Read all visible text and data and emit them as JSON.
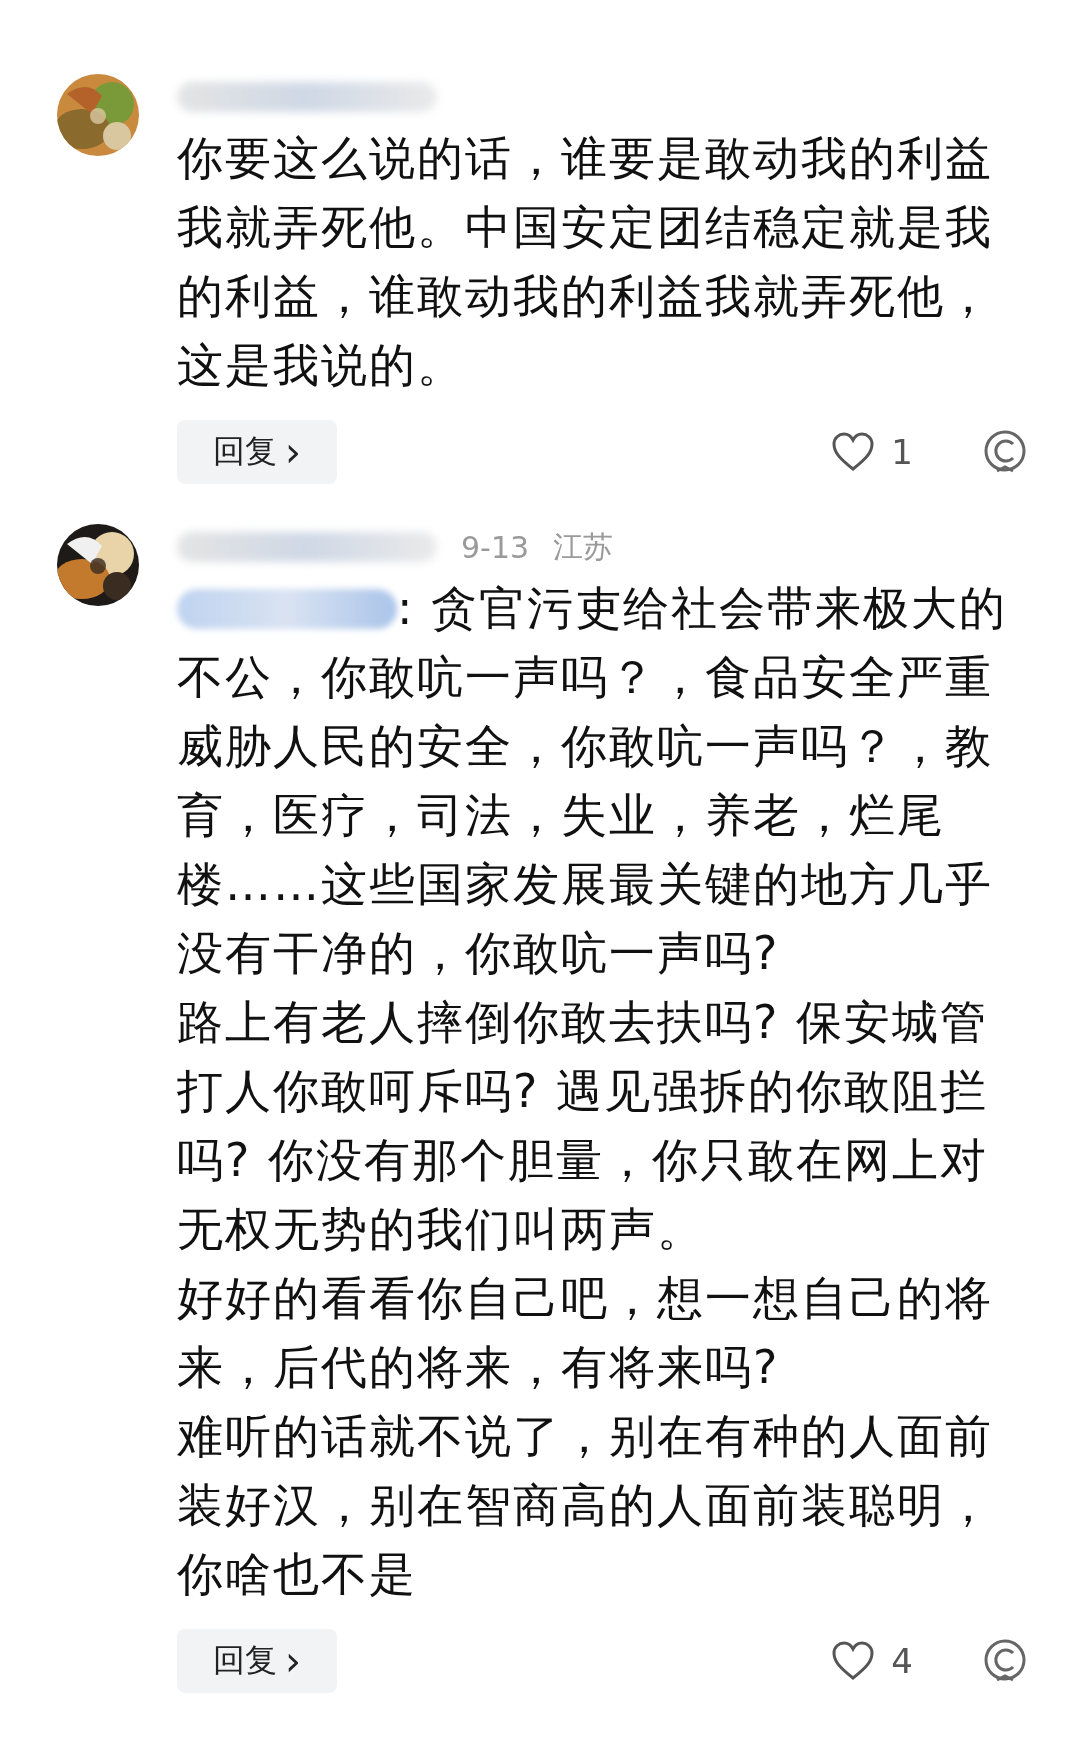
{
  "comments": [
    {
      "avatar": {
        "kind": "picture"
      },
      "paragraphs": [
        {
          "kind": "plain",
          "text": "你要这么说的话，谁要是敢动我的利益我就弄死他。中国安定团结稳定就是我的利益，谁敢动我的利益我就弄死他，这是我说的。"
        }
      ],
      "reply": {
        "label": "回复",
        "chevron": "›"
      },
      "likes": "1"
    },
    {
      "avatar": {
        "kind": "picture"
      },
      "date": "9-13",
      "location": "江苏",
      "paragraphs": [
        {
          "kind": "mention",
          "text": ": 贪官污吏给社会带来极大的"
        },
        {
          "kind": "plain",
          "text": "不公，你敢吭一声吗？，食品安全严重威胁人民的安全，你敢吭一声吗？，教育，医疗，司法，失业，养老，烂尾楼……这些国家发展最关键的地方几乎没有干净的，你敢吭一声吗?"
        },
        {
          "kind": "plain",
          "text": "路上有老人摔倒你敢去扶吗? 保安城管打人你敢呵斥吗? 遇见强拆的你敢阻拦吗? 你没有那个胆量，你只敢在网上对无权无势的我们叫两声。"
        },
        {
          "kind": "plain",
          "text": "好好的看看你自己吧，想一想自己的将来，后代的将来，有将来吗?"
        },
        {
          "kind": "plain",
          "text": "难听的话就不说了，别在有种的人面前装好汉，别在智商高的人面前装聪明，你啥也不是"
        }
      ],
      "reply": {
        "label": "回复",
        "chevron": "›"
      },
      "likes": "4"
    }
  ]
}
